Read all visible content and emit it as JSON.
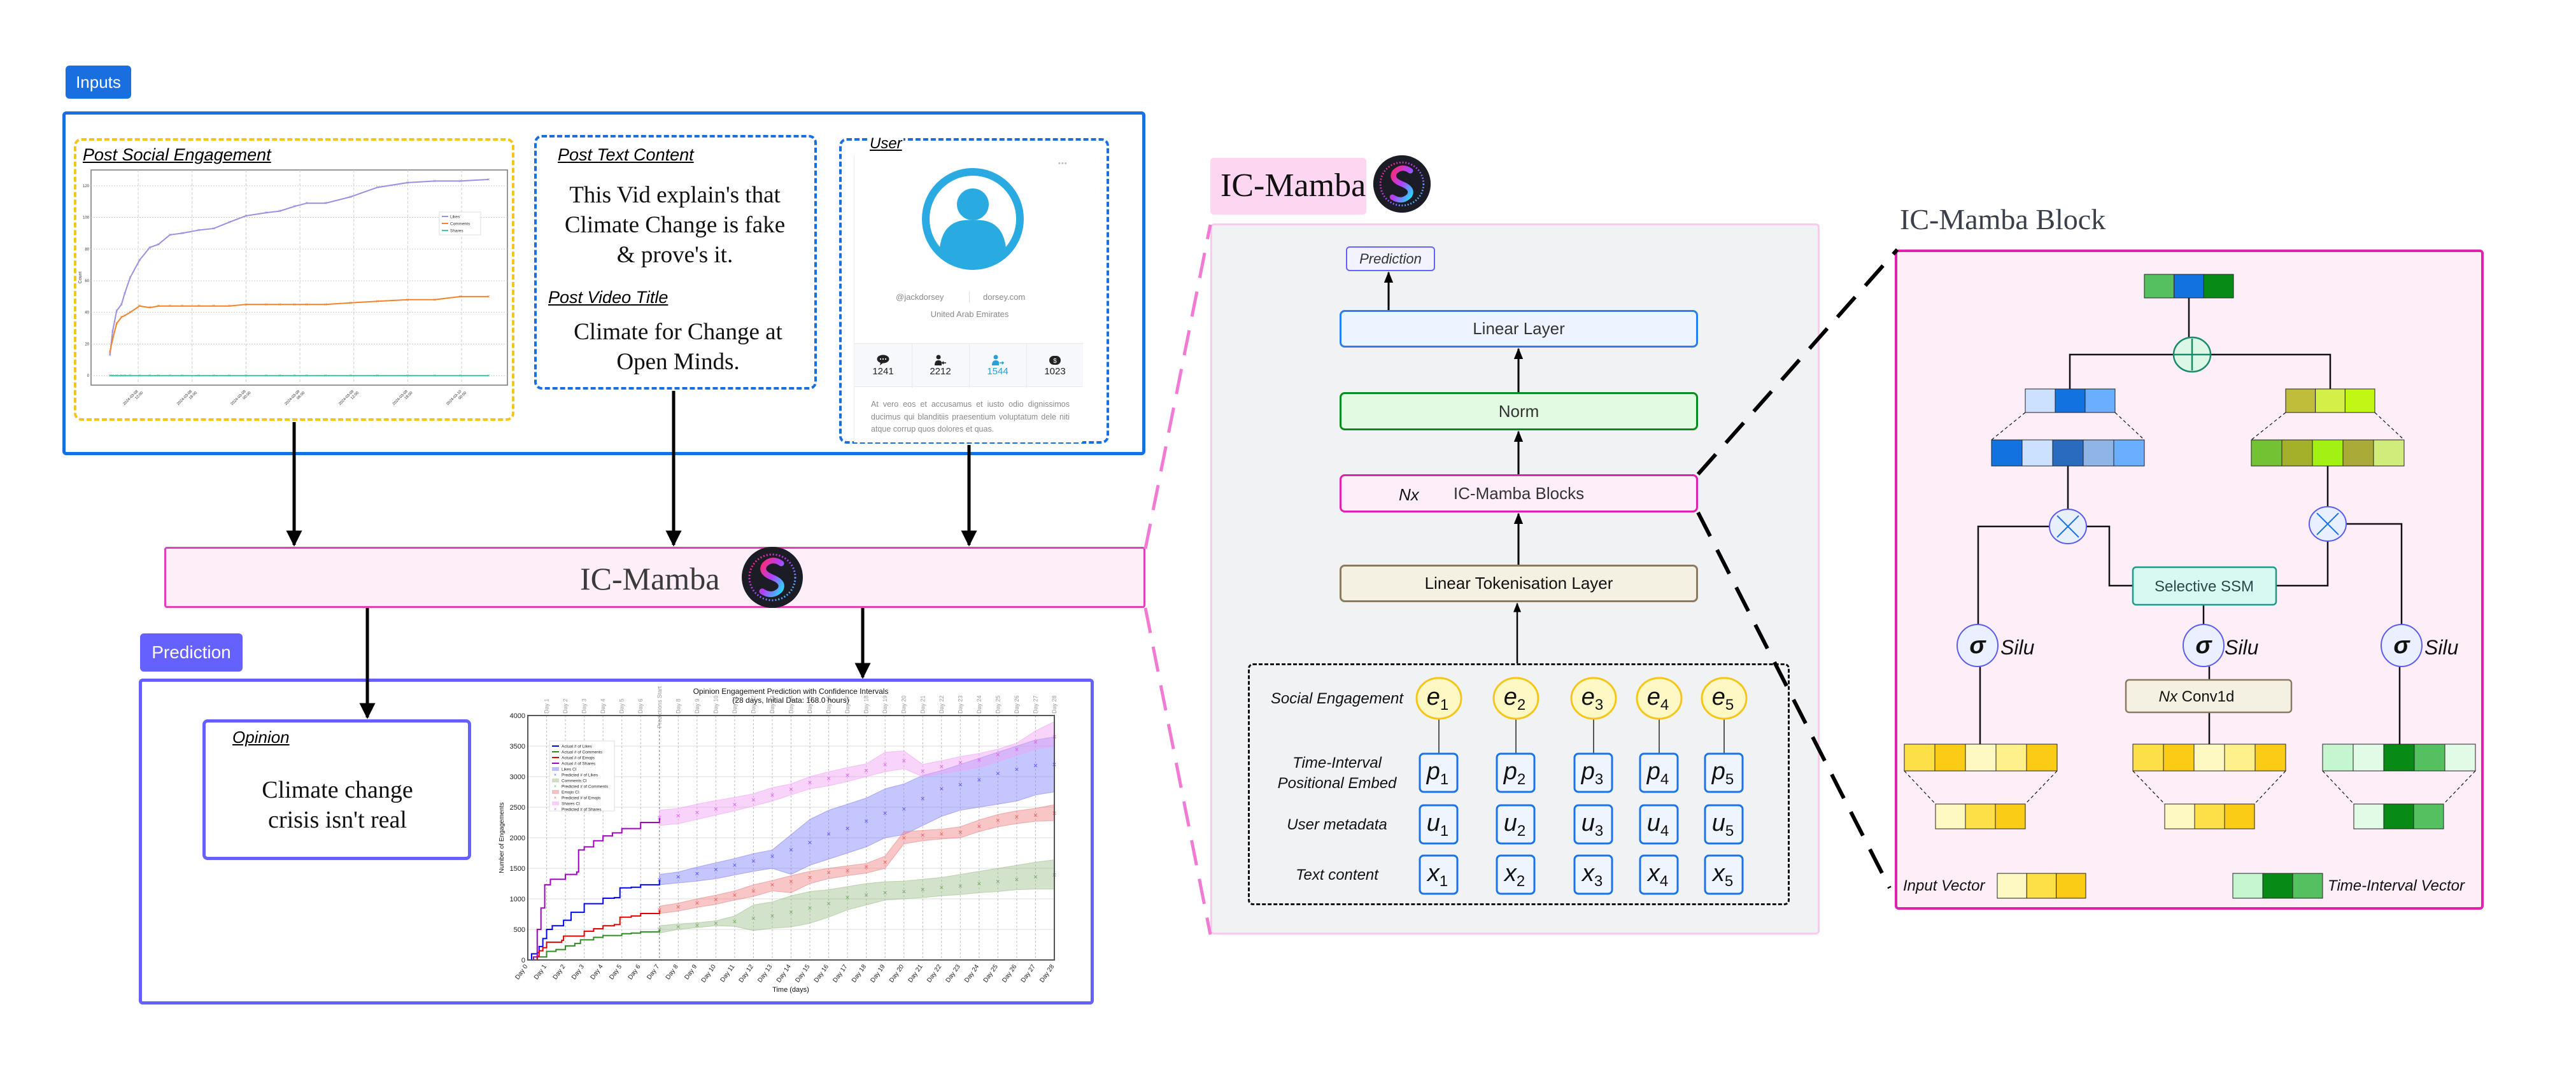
{
  "inputs": {
    "tag": "Inputs",
    "engagement_title": "Post Social Engagement",
    "text_content": {
      "title": "Post Text Content",
      "body_lines": [
        "This Vid explain's that",
        "Climate Change is fake",
        "& prove's it."
      ],
      "video_title_label": "Post Video Title",
      "video_title_lines": [
        "Climate for Change at",
        "Open Minds."
      ]
    },
    "user": {
      "title": "User",
      "menu": "•••",
      "handle": "@jackdorsey",
      "website": "dorsey.com",
      "location": "United Arab Emirates",
      "stats": [
        {
          "icon": "chat-bubble-icon",
          "value": "1241"
        },
        {
          "icon": "user-incoming-icon",
          "value": "2212"
        },
        {
          "icon": "user-outgoing-icon",
          "value": "1544"
        },
        {
          "icon": "dollar-badge-icon",
          "value": "1023"
        }
      ],
      "bio": "At vero eos et accusamus et iusto odio dignissimos ducimus qui blanditiis praesentium voluptatum dele niti atque corrup quos dolores et quas.",
      "avatar_color": "#29abe2",
      "highlight_color": "#2a9fd6"
    }
  },
  "model_banner": {
    "title": "IC-Mamba"
  },
  "prediction": {
    "tag": "Prediction",
    "opinion_label": "Opinion",
    "opinion_lines": [
      "Climate change",
      "crisis isn't real"
    ]
  },
  "architecture": {
    "title": "IC-Mamba",
    "prediction": "Prediction",
    "linear_layer": "Linear Layer",
    "norm": "Norm",
    "blocks_multiplier": "Nx",
    "blocks": "IC-Mamba Blocks",
    "tokenisation": "Linear Tokenisation Layer",
    "rows": [
      {
        "label_lines": [
          "Social Engagement"
        ],
        "symbol": "e"
      },
      {
        "label_lines": [
          "Time-Interval",
          "Positional Embed"
        ],
        "symbol": "p"
      },
      {
        "label_lines": [
          "User metadata"
        ],
        "symbol": "u"
      },
      {
        "label_lines": [
          "Text content"
        ],
        "symbol": "x"
      }
    ],
    "indices": [
      "1",
      "2",
      "3",
      "4",
      "5"
    ]
  },
  "block": {
    "title": "IC-Mamba Block",
    "ssm": "Selective SSM",
    "activation_symbol": "σ",
    "activation": "Silu",
    "conv_multiplier": "Nx",
    "conv": "Conv1d",
    "legend_input": "Input Vector",
    "legend_time": "Time-Interval Vector",
    "colors": {
      "output": [
        "#55c060",
        "#1273e0",
        "#078a16"
      ],
      "left_small": [
        "#cce0ff",
        "#1273e0",
        "#6aaeff"
      ],
      "left_big": [
        "#1273e0",
        "#cce0ff",
        "#2a6bbf",
        "#8fb4e6",
        "#6aaeff"
      ],
      "right_small": [
        "#c0bd3a",
        "#d4ef48",
        "#c2f615"
      ],
      "right_big": [
        "#72c234",
        "#a2b02a",
        "#a3f015",
        "#aaaa38",
        "#d0ec7a"
      ],
      "input_big": [
        "#fde047",
        "#facc15",
        "#fef9c3",
        "#fef08a",
        "#facc15"
      ],
      "input_small": [
        "#fef9c3",
        "#fde047",
        "#facc15"
      ],
      "time_big": [
        "#c6f6d0",
        "#e2fbe6",
        "#078a16",
        "#55c060",
        "#e2fbe6"
      ],
      "time_small": [
        "#e2fbe6",
        "#078a16",
        "#55c060"
      ],
      "legend_time": [
        "#c6f6d0",
        "#078a16",
        "#55c060"
      ]
    }
  },
  "colors": {
    "inputs_blue": "#1a6fe0",
    "prediction_purple": "#6461ff",
    "engagement_yellow": "#f5c518",
    "banner_fill": "#fdeef8",
    "banner_stroke": "#e040b8",
    "block_stroke": "#e020b0"
  },
  "chart_data": [
    {
      "type": "line",
      "ylabel": "Count",
      "ylim": [
        -6,
        130
      ],
      "xlim": [
        "2024-03-08T06:45",
        "2024-03-10T05:06"
      ],
      "yticks": [
        0,
        20,
        40,
        60,
        80,
        100,
        120
      ],
      "xticks": [
        {
          "at": "2024-03-08T12:00",
          "date": "2024-03-08",
          "time": "12:00"
        },
        {
          "at": "2024-03-08T18:00",
          "date": "2024-03-08",
          "time": "18:00"
        },
        {
          "at": "2024-03-09T00:00",
          "date": "2024-03-09",
          "time": "00:00"
        },
        {
          "at": "2024-03-09T06:00",
          "date": "2024-03-09",
          "time": "06:00"
        },
        {
          "at": "2024-03-09T12:00",
          "date": "2024-03-09",
          "time": "12:00"
        },
        {
          "at": "2024-03-09T18:00",
          "date": "2024-03-09",
          "time": "18:00"
        },
        {
          "at": "2024-03-10T00:00",
          "date": "2024-03-10",
          "time": "00:00"
        }
      ],
      "grid": true,
      "legend_position": "right-middle",
      "x": [
        "2024-03-08T08:51",
        "2024-03-08T09:09",
        "2024-03-08T09:36",
        "2024-03-08T10:08",
        "2024-03-08T10:30",
        "2024-03-08T11:06",
        "2024-03-08T12:09",
        "2024-03-08T13:17",
        "2024-03-08T14:15",
        "2024-03-08T15:32",
        "2024-03-08T16:53",
        "2024-03-08T18:45",
        "2024-03-08T20:24",
        "2024-03-08T22:08",
        "2024-03-09T00:00",
        "2024-03-09T02:15",
        "2024-03-09T03:45",
        "2024-03-09T05:24",
        "2024-03-09T06:45",
        "2024-03-09T08:51",
        "2024-03-09T11:38",
        "2024-03-09T14:38",
        "2024-03-09T18:00",
        "2024-03-09T21:00",
        "2024-03-09T23:51",
        "2024-03-10T03:00"
      ],
      "series": [
        {
          "name": "Likes",
          "color": "#9a8fe0",
          "values": [
            13,
            28,
            41,
            45,
            52,
            62,
            73,
            81,
            83,
            89,
            90,
            92,
            93,
            97,
            101,
            103,
            104,
            107,
            109,
            109,
            113,
            119,
            122,
            123,
            123,
            124
          ]
        },
        {
          "name": "Comments",
          "color": "#f5822a",
          "values": [
            15,
            23,
            33,
            37,
            38,
            40,
            44,
            43,
            44,
            44,
            44,
            44,
            44,
            44,
            45,
            45,
            45,
            45,
            45,
            45,
            46,
            47,
            48,
            48,
            50,
            50
          ]
        },
        {
          "name": "Shares",
          "color": "#3cc8a0",
          "values": [
            0,
            0,
            0,
            0,
            0,
            0,
            0,
            0,
            0,
            0,
            0,
            0,
            0,
            0,
            0,
            0,
            0,
            0,
            0,
            0,
            0,
            0,
            0,
            0,
            0,
            0
          ]
        }
      ]
    },
    {
      "type": "line",
      "title": "Opinion Engagement Prediction with Confidence Intervals",
      "subtitle": "(28 days, Initial Data: 168.0 hours)",
      "xlabel": "Time (days)",
      "ylabel": "Number of Engagements",
      "xlim": [
        0,
        28
      ],
      "ylim": [
        0,
        4000
      ],
      "yticks": [
        0,
        500,
        1000,
        1500,
        2000,
        2500,
        3000,
        3500,
        4000
      ],
      "xtick_labels": [
        "Day 0",
        "Day 1",
        "Day 2",
        "Day 3",
        "Day 4",
        "Day 5",
        "Day 6",
        "Day 7",
        "Day 8",
        "Day 9",
        "Day 10",
        "Day 11",
        "Day 12",
        "Day 13",
        "Day 14",
        "Day 15",
        "Day 16",
        "Day 17",
        "Day 18",
        "Day 19",
        "Day 20",
        "Day 21",
        "Day 22",
        "Day 23",
        "Day 24",
        "Day 25",
        "Day 26",
        "Day 27",
        "Day 28"
      ],
      "prediction_start_day": 7,
      "prediction_start_label": "Predictions Start",
      "grid": true,
      "legend_position": "upper-left",
      "actual": [
        {
          "name": "Actual # of Likes",
          "color": "#0000ff",
          "x": [
            0,
            0.2,
            0.5,
            0.6,
            0.8,
            1,
            1.3,
            1.8,
            1.9,
            2.3,
            3,
            4,
            4.6,
            4.9,
            5.5,
            6,
            7
          ],
          "y": [
            0,
            100,
            120,
            220,
            350,
            500,
            560,
            560,
            650,
            780,
            920,
            1010,
            1020,
            1180,
            1190,
            1230,
            1310
          ]
        },
        {
          "name": "Actual # of Comments",
          "color": "#2e8b22",
          "x": [
            0,
            0.5,
            1,
            1.5,
            2,
            2.5,
            2.8,
            3.5,
            4,
            5,
            5.5,
            6,
            7
          ],
          "y": [
            0,
            50,
            140,
            170,
            230,
            270,
            330,
            370,
            400,
            430,
            440,
            460,
            500
          ]
        },
        {
          "name": "Actual # of Emojis",
          "color": "#e00000",
          "x": [
            0,
            0.5,
            0.6,
            0.8,
            1,
            1.8,
            1.9,
            3,
            3.5,
            4,
            4.6,
            4.9,
            5.5,
            6,
            7
          ],
          "y": [
            0,
            60,
            150,
            200,
            290,
            320,
            390,
            470,
            510,
            560,
            580,
            700,
            720,
            760,
            820
          ]
        },
        {
          "name": "Actual # of Shares",
          "color": "#a000c0",
          "x": [
            0,
            0.3,
            0.5,
            0.7,
            0.9,
            1.2,
            2,
            2.6,
            2.7,
            3,
            3.5,
            4,
            4.5,
            5,
            6,
            7
          ],
          "y": [
            0,
            50,
            500,
            850,
            1230,
            1320,
            1400,
            1440,
            1800,
            1850,
            1950,
            2030,
            2080,
            2150,
            2250,
            2320
          ]
        }
      ],
      "predicted": [
        {
          "name": "Predicted # of Likes",
          "ci_name": "Likes CI",
          "color": "#5555ff",
          "ci_color": "#8080ff",
          "x": [
            7,
            8,
            9,
            10,
            11,
            12,
            13,
            14,
            15,
            16,
            17,
            18,
            19,
            20,
            21,
            22,
            23,
            24,
            25,
            26,
            27,
            28
          ],
          "y": [
            1310,
            1360,
            1410,
            1480,
            1550,
            1620,
            1700,
            1800,
            1920,
            2060,
            2150,
            2270,
            2400,
            2470,
            2640,
            2800,
            2870,
            2950,
            3050,
            3120,
            3180,
            3200
          ],
          "lower": [
            1230,
            1260,
            1290,
            1330,
            1390,
            1450,
            1500,
            1400,
            1550,
            1650,
            1750,
            1850,
            2000,
            2050,
            2200,
            2350,
            2450,
            2500,
            2550,
            2600,
            2700,
            2750
          ],
          "upper": [
            1400,
            1440,
            1520,
            1590,
            1660,
            1740,
            1800,
            2050,
            2300,
            2450,
            2550,
            2650,
            2800,
            2880,
            3020,
            3100,
            3200,
            3300,
            3400,
            3500,
            3600,
            3650
          ]
        },
        {
          "name": "Predicted # of Comments",
          "ci_name": "Comments CI",
          "color": "#7aa86a",
          "ci_color": "#9dc08b",
          "x": [
            7,
            8,
            9,
            10,
            11,
            12,
            13,
            14,
            15,
            16,
            17,
            18,
            19,
            20,
            21,
            22,
            23,
            24,
            25,
            26,
            27,
            28
          ],
          "y": [
            500,
            540,
            570,
            600,
            630,
            680,
            720,
            780,
            850,
            920,
            1020,
            1060,
            1100,
            1120,
            1150,
            1190,
            1210,
            1250,
            1280,
            1320,
            1360,
            1390
          ],
          "lower": [
            440,
            500,
            530,
            560,
            550,
            480,
            520,
            540,
            600,
            700,
            820,
            900,
            980,
            1000,
            1020,
            1050,
            1070,
            1100,
            1120,
            1150,
            1160,
            1160
          ],
          "upper": [
            560,
            590,
            610,
            640,
            720,
            900,
            950,
            1050,
            1120,
            1150,
            1200,
            1250,
            1280,
            1290,
            1320,
            1350,
            1400,
            1450,
            1500,
            1550,
            1600,
            1640
          ]
        },
        {
          "name": "Predicted # of Emojis",
          "ci_name": "Emojis CI",
          "color": "#f06060",
          "ci_color": "#f08080",
          "x": [
            7,
            8,
            9,
            10,
            11,
            12,
            13,
            14,
            15,
            16,
            17,
            18,
            19,
            20,
            21,
            22,
            23,
            24,
            25,
            26,
            27,
            28
          ],
          "y": [
            820,
            870,
            930,
            990,
            1060,
            1130,
            1230,
            1280,
            1350,
            1430,
            1460,
            1520,
            1600,
            2000,
            2040,
            2060,
            2090,
            2190,
            2280,
            2340,
            2370,
            2400
          ],
          "lower": [
            760,
            800,
            860,
            910,
            980,
            1040,
            1130,
            1100,
            1250,
            1330,
            1380,
            1420,
            1500,
            1900,
            1950,
            1980,
            2000,
            2100,
            2180,
            2230,
            2270,
            2280
          ],
          "upper": [
            880,
            930,
            1000,
            1060,
            1130,
            1230,
            1300,
            1380,
            1450,
            1500,
            1540,
            1580,
            1700,
            2100,
            2120,
            2140,
            2180,
            2290,
            2380,
            2440,
            2480,
            2540
          ]
        },
        {
          "name": "Predicted # of Shares",
          "ci_name": "Shares CI",
          "color": "#e060f0",
          "ci_color": "#f0a0f5",
          "x": [
            7,
            8,
            9,
            10,
            11,
            12,
            13,
            14,
            15,
            16,
            17,
            18,
            19,
            20,
            21,
            22,
            23,
            24,
            25,
            26,
            27,
            28
          ],
          "y": [
            2330,
            2360,
            2410,
            2470,
            2540,
            2620,
            2700,
            2790,
            2900,
            2970,
            3020,
            3100,
            3200,
            3260,
            3090,
            3160,
            3230,
            3270,
            3360,
            3450,
            3570,
            3650
          ],
          "lower": [
            2200,
            2230,
            2300,
            2370,
            2440,
            2520,
            2600,
            2700,
            2800,
            2850,
            2920,
            3000,
            3080,
            3130,
            3000,
            3050,
            3100,
            3150,
            3250,
            3350,
            3450,
            3500
          ],
          "upper": [
            2450,
            2480,
            2550,
            2610,
            2660,
            2720,
            2820,
            2880,
            3000,
            3080,
            3150,
            3210,
            3400,
            3420,
            3200,
            3260,
            3330,
            3380,
            3450,
            3550,
            3750,
            3900
          ]
        }
      ]
    }
  ]
}
